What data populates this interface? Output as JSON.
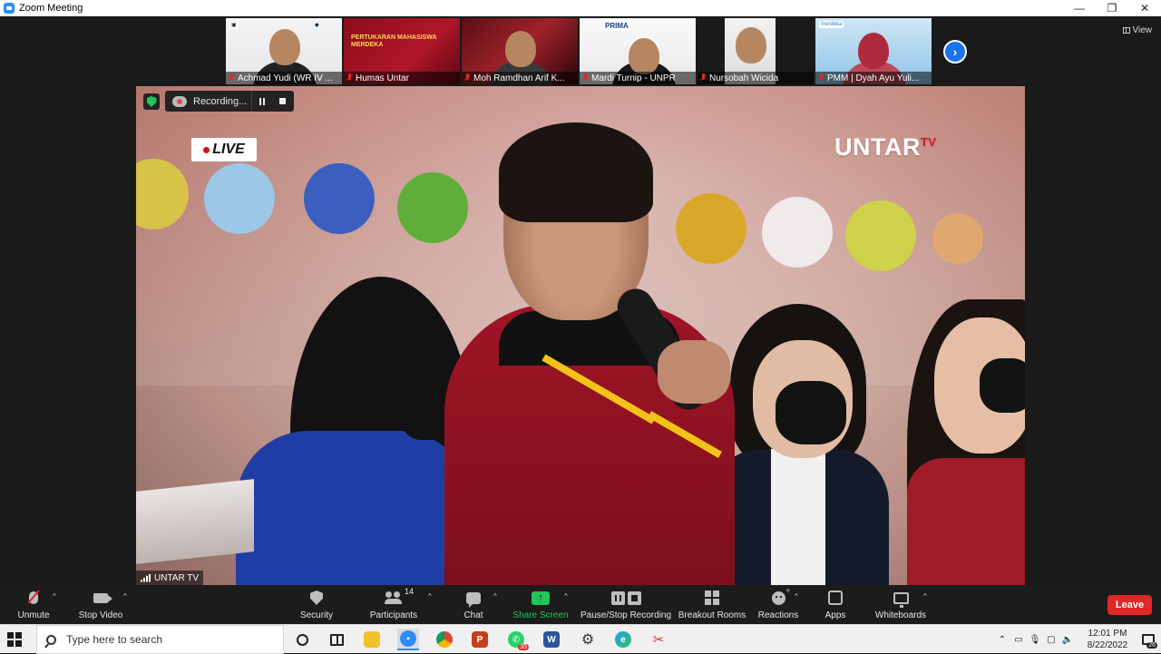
{
  "window": {
    "title": "Zoom Meeting",
    "minimize": "—",
    "restore": "❐",
    "close": "✕"
  },
  "view_button": {
    "label": "View",
    "icon": "grid-icon"
  },
  "participants_strip": [
    {
      "name": "Achmad Yudi (WR IV ...",
      "muted": true
    },
    {
      "name": "Humas Untar",
      "muted": true,
      "banner": "PERTUKARAN MAHASISWA MERDEKA"
    },
    {
      "name": "Moh Ramdhan Arif K...",
      "muted": true
    },
    {
      "name": "Mardi Turnip - UNPR",
      "muted": true,
      "logo": "PRIMA"
    },
    {
      "name": "Nursobah Wicida",
      "muted": true
    },
    {
      "name": "PMM | Dyah Ayu Yuli...",
      "muted": true,
      "logo": "merdeka"
    }
  ],
  "main_video": {
    "live_label": "LIVE",
    "channel_logo": "UNTAR",
    "channel_logo_suffix": "TV",
    "watermark": "UNTAR TV"
  },
  "recording": {
    "status": "Recording...",
    "pause_icon": "pause-icon",
    "stop_icon": "stop-icon"
  },
  "toolbar": {
    "unmute": "Unmute",
    "stop_video": "Stop Video",
    "security": "Security",
    "participants": "Participants",
    "participants_count": "14",
    "chat": "Chat",
    "share_screen": "Share Screen",
    "pause_stop_recording": "Pause/Stop Recording",
    "breakout_rooms": "Breakout Rooms",
    "reactions": "Reactions",
    "apps": "Apps",
    "whiteboards": "Whiteboards",
    "leave": "Leave",
    "caret": "^"
  },
  "taskbar": {
    "search_placeholder": "Type here to search",
    "time": "12:01 PM",
    "date": "8/22/2022",
    "notification_count": "26",
    "whatsapp_badge": "35"
  },
  "colors": {
    "accent_blue": "#2d8cff",
    "share_green": "#23c45a",
    "leave_red": "#e02828"
  }
}
